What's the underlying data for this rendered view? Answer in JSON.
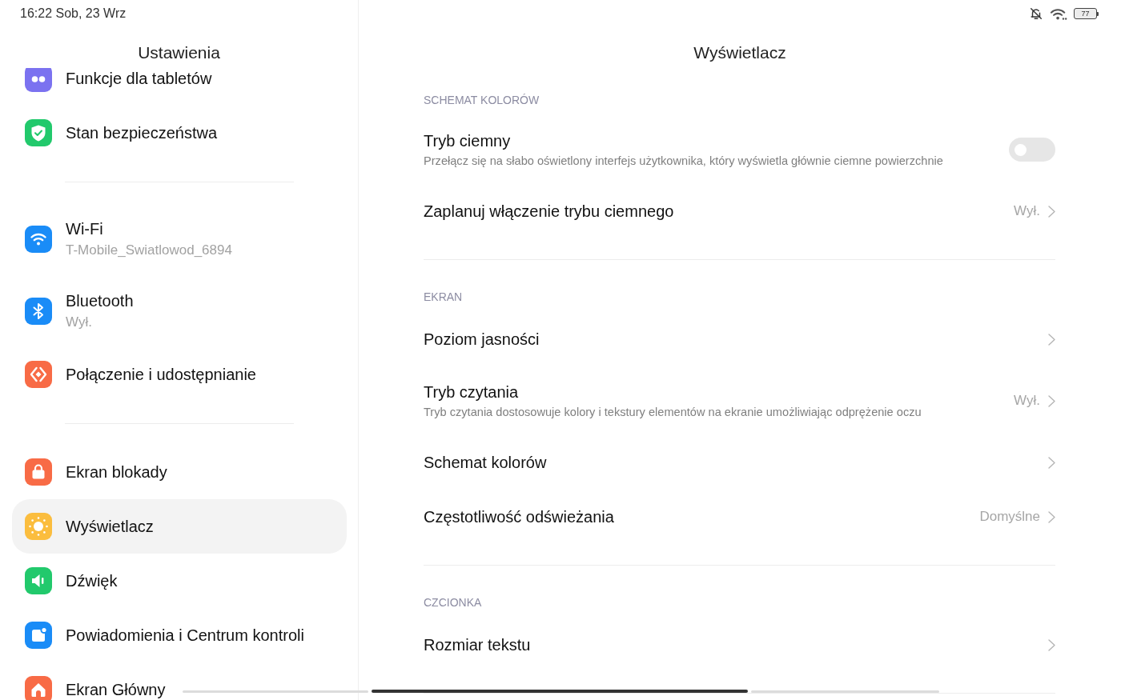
{
  "status_bar": {
    "time": "16:22 Sob, 23 Wrz",
    "battery": "77"
  },
  "sidebar": {
    "title": "Ustawienia",
    "groups": [
      {
        "items": [
          {
            "label": "Funkcje dla tabletów",
            "color": "#7b72f0",
            "selected": false
          },
          {
            "label": "Stan bezpieczeństwa",
            "color": "#22c96c",
            "selected": false
          }
        ]
      },
      {
        "items": [
          {
            "label": "Wi-Fi",
            "subtitle": "T-Mobile_Swiatlowod_6894",
            "color": "#1a8cf7",
            "selected": false
          },
          {
            "label": "Bluetooth",
            "subtitle": "Wył.",
            "color": "#1a8cf7",
            "selected": false
          },
          {
            "label": "Połączenie i udostępnianie",
            "color": "#f86b46",
            "selected": false
          }
        ]
      },
      {
        "items": [
          {
            "label": "Ekran blokady",
            "color": "#f86b46",
            "selected": false
          },
          {
            "label": "Wyświetlacz",
            "color": "#fbbd3e",
            "selected": true
          },
          {
            "label": "Dźwięk",
            "color": "#22c96c",
            "selected": false
          },
          {
            "label": "Powiadomienia i Centrum kontroli",
            "color": "#1a8cf7",
            "selected": false
          },
          {
            "label": "Ekran Główny",
            "color": "#f86b46",
            "selected": false
          }
        ]
      }
    ]
  },
  "detail": {
    "title": "Wyświetlacz",
    "sections": [
      {
        "label": "SCHEMAT KOLORÓW",
        "rows": [
          {
            "kind": "toggle",
            "title": "Tryb ciemny",
            "description": "Przełącz się na słabo oświetlony interfejs użytkownika, który wyświetla głównie ciemne powierzchnie",
            "on": false
          },
          {
            "kind": "link",
            "title": "Zaplanuj włączenie trybu ciemnego",
            "value": "Wył."
          }
        ]
      },
      {
        "label": "EKRAN",
        "rows": [
          {
            "kind": "link",
            "title": "Poziom jasności"
          },
          {
            "kind": "link",
            "title": "Tryb czytania",
            "description": "Tryb czytania dostosowuje kolory i tekstury elementów na ekranie umożliwiając odprężenie oczu",
            "value": "Wył."
          },
          {
            "kind": "link",
            "title": "Schemat kolorów"
          },
          {
            "kind": "link",
            "title": "Częstotliwość odświeżania",
            "value": "Domyślne"
          }
        ]
      },
      {
        "label": "CZCIONKA",
        "rows": [
          {
            "kind": "link",
            "title": "Rozmiar tekstu"
          }
        ]
      }
    ]
  }
}
